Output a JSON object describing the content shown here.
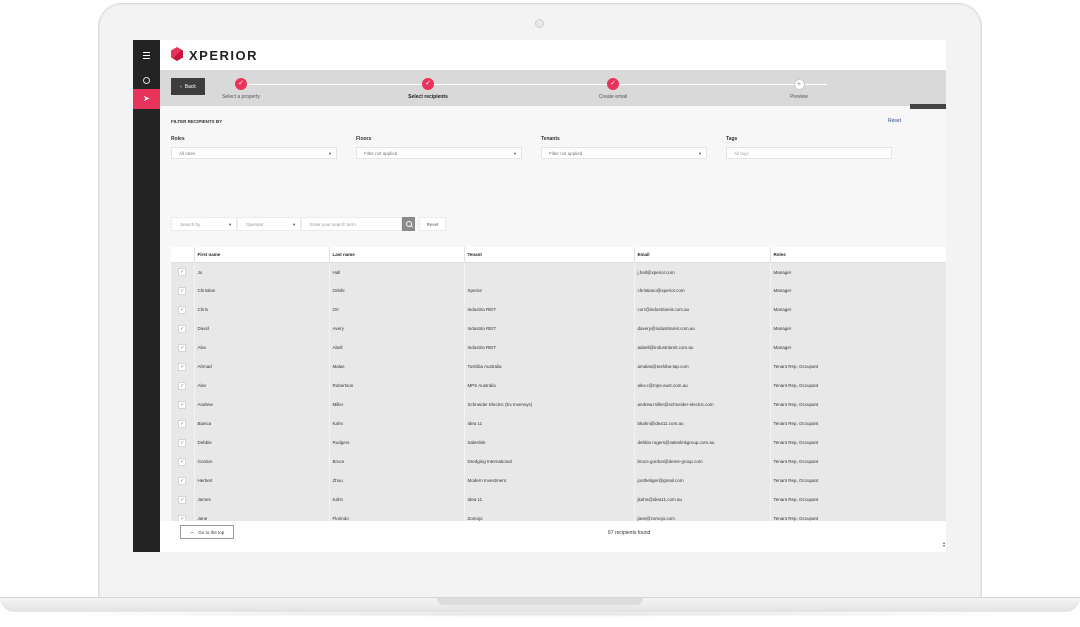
{
  "app": {
    "logo_text": "XPERIOR"
  },
  "stepper": {
    "back_label": "Back",
    "steps": [
      {
        "label": "Select a property",
        "state": "done"
      },
      {
        "label": "Select recipients",
        "state": "active"
      },
      {
        "label": "Create email",
        "state": "done"
      },
      {
        "label": "Preview",
        "state": "pending"
      }
    ]
  },
  "filters": {
    "title": "FILTER RECIPIENTS BY",
    "reset_label": "Reset",
    "roles": {
      "label": "Roles",
      "value": "All roles"
    },
    "floors": {
      "label": "Floors",
      "value": "Filter not applied"
    },
    "tenants": {
      "label": "Tenants",
      "value": "Filter not applied"
    },
    "tags": {
      "label": "Tags",
      "placeholder": "All tags"
    }
  },
  "search": {
    "search_by": "Search by",
    "operator": "Operator",
    "placeholder": "Enter your search term",
    "reset_label": "Reset"
  },
  "table": {
    "columns": [
      "",
      "First name",
      "Last name",
      "Tenant",
      "Email",
      "Roles"
    ],
    "rows": [
      [
        "Jo",
        "Hall",
        "",
        "j.hall@xperior.com",
        "Manager"
      ],
      [
        "Christian",
        "Orlebi",
        "Xperior",
        "christiano@xperior.com",
        "Manager"
      ],
      [
        "Chris",
        "Orr",
        "Industria REIT",
        "corr@industriareit.com.au",
        "Manager"
      ],
      [
        "David",
        "Avery",
        "Industria REIT",
        "davery@industriareit.com.au",
        "Manager"
      ],
      [
        "Alex",
        "Abell",
        "Industria REIT",
        "aabell@industriareit.com.au",
        "Manager"
      ],
      [
        "Ahmad",
        "Malas",
        "Toshiba Australia",
        "amalas@toshiba-tap.com",
        "Tenant Rep, Occupant"
      ],
      [
        "Alex",
        "Robertson",
        "MPS Australia",
        "alex.r@mps-aust.com.au",
        "Tenant Rep, Occupant"
      ],
      [
        "Andrew",
        "Miller",
        "Schneider Electric (Ex Invensys)",
        "andrew.miller@schneider-electric.com",
        "Tenant Rep, Occupant"
      ],
      [
        "Bianca",
        "Kahn",
        "Idea 11",
        "bkahn@idea11.com.au",
        "Tenant Rep, Occupant"
      ],
      [
        "Debbie",
        "Rodgers",
        "Saleslink",
        "debbie.rogers@saleslinkgroup.com.au",
        "Tenant Rep, Occupant"
      ],
      [
        "Gordon",
        "Bruce",
        "Dredging International",
        "bruce.gordon@deme-group.com",
        "Tenant Rep, Occupant"
      ],
      [
        "Herbert",
        "Zhou",
        "Modern Investment",
        "joothetiger@gmail.com",
        "Tenant Rep, Occupant"
      ],
      [
        "James",
        "Kahn",
        "Idea 11",
        "jkahn@idea11.com.au",
        "Tenant Rep, Occupant"
      ],
      [
        "Jane",
        "Florindo",
        "Zomojo",
        "jane@zomojo.com",
        "Tenant Rep, Occupant"
      ]
    ]
  },
  "footer": {
    "go_top_label": "Go to the top",
    "found_text": "67 recipients found"
  },
  "colors": {
    "accent": "#e8335a",
    "sidebar": "#232323",
    "check": "#3aa53a"
  }
}
